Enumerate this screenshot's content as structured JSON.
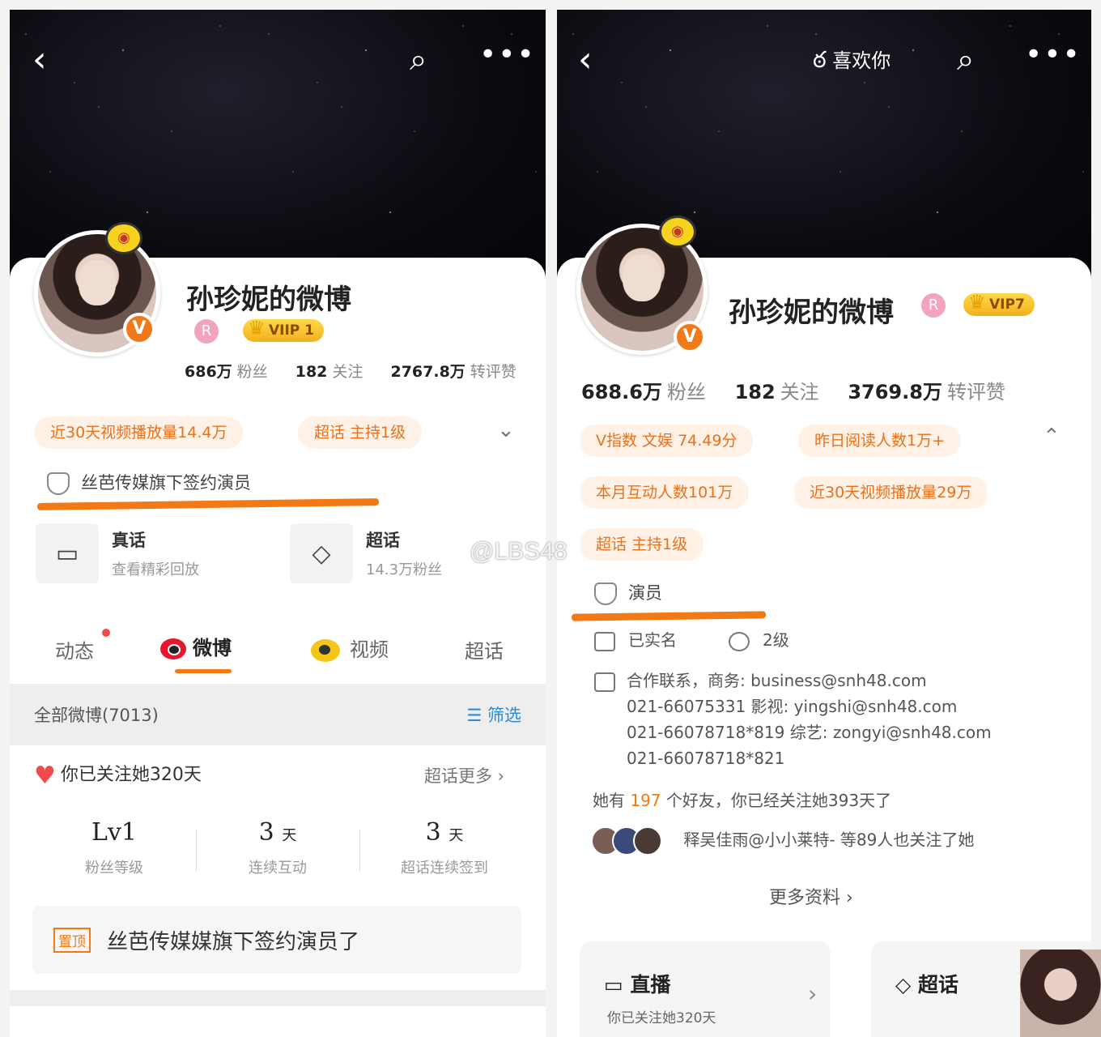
{
  "left": {
    "name": "孙珍妮的微博",
    "vip_label": "VIIP 1",
    "followers_value": "686万",
    "followers_label": "粉丝",
    "following_value": "182",
    "following_label": "关注",
    "reposts_value": "2767.8万",
    "reposts_label": "转评赞",
    "chips": [
      "近30天视频播放量14.4万",
      "超话 主持1级"
    ],
    "verify_text": "丝芭传媒旗下签约演员",
    "entries": [
      {
        "title": "真话",
        "sub": "查看精彩回放"
      },
      {
        "title": "超话",
        "sub": "14.3万粉丝"
      }
    ],
    "tabs": [
      "动态",
      "微博",
      "视频",
      "超话"
    ],
    "filter_label": "全部微博(7013)",
    "filter_button": "筛选",
    "follow_days": "你已关注她320天",
    "more_chaohua": "超话更多",
    "fan_stats": [
      {
        "value": "Lv1",
        "unit": "",
        "label": "粉丝等级"
      },
      {
        "value": "3",
        "unit": "天",
        "label": "连续互动"
      },
      {
        "value": "3",
        "unit": "天",
        "label": "超话连续签到"
      }
    ],
    "pinned_tag": "置顶",
    "pinned_text": "丝芭传媒媒旗下签约演员了"
  },
  "right": {
    "like_label": "喜欢你",
    "name": "孙珍妮的微博",
    "vip_label": "VIP7",
    "followers_value": "688.6万",
    "followers_label": "粉丝",
    "following_value": "182",
    "following_label": "关注",
    "reposts_value": "3769.8万",
    "reposts_label": "转评赞",
    "chips": [
      "V指数 文娱 74.49分",
      "昨日阅读人数1万+",
      "本月互动人数101万",
      "近30天视频播放量29万",
      "超话 主持1级"
    ],
    "verify_text": "演员",
    "info1": "已实名",
    "info2": "2级",
    "contact_lines": [
      "合作联系，商务: business@snh48.com",
      "021-66075331 影视: yingshi@snh48.com",
      "021-66078718*819 综艺: zongyi@snh48.com",
      "021-66078718*821"
    ],
    "common_prefix": "她有",
    "common_count": "197",
    "common_suffix": "个好友，你已经关注她393天了",
    "common_fans": "释吴佳雨@小小莱特- 等89人也关注了她",
    "more_info": "更多资料",
    "live_title": "直播",
    "live_sub": "你已关注她320天",
    "chaohua_title": "超话"
  },
  "watermark": "@LBS48"
}
